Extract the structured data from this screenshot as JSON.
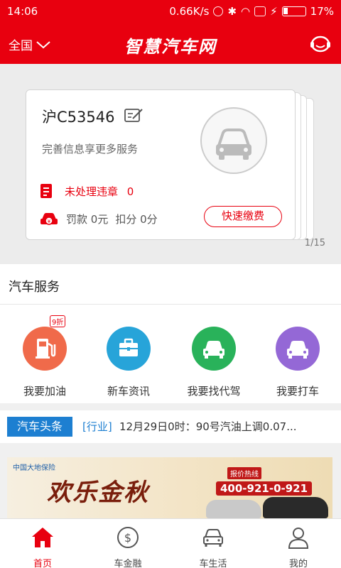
{
  "status_bar": {
    "time": "14:06",
    "net_speed": "0.66K/s",
    "battery_percent": "17%"
  },
  "header": {
    "region": "全国",
    "title": "智慧汽车网"
  },
  "car_card": {
    "plate": "沪C53546",
    "subtitle": "完善信息享更多服务",
    "violations_label": "未处理违章",
    "violations_count": "0",
    "fine_label": "罚款",
    "fine_value": "0元",
    "points_label": "扣分",
    "points_value": "0分",
    "quick_pay": "快速缴费",
    "pager": "1/15"
  },
  "services": {
    "title": "汽车服务",
    "discount_badge": "9折",
    "items": [
      {
        "label": "我要加油",
        "color": "#f06a4a",
        "icon": "fuel-pump-icon"
      },
      {
        "label": "新车资讯",
        "color": "#27a4d9",
        "icon": "briefcase-icon"
      },
      {
        "label": "我要找代驾",
        "color": "#29b25a",
        "icon": "car-icon"
      },
      {
        "label": "我要打车",
        "color": "#9468d6",
        "icon": "car-icon"
      }
    ]
  },
  "headline": {
    "tag": "汽车头条",
    "category": "[行业]",
    "text": "12月29日0时：90号汽油上调0.07..."
  },
  "banner": {
    "logo_text": "中国大地保险",
    "title": "欢乐金秋",
    "hotline_label": "报价热线",
    "hotline": "400-921-0-921"
  },
  "tabbar": {
    "items": [
      {
        "label": "首页",
        "icon": "home-icon",
        "active": true
      },
      {
        "label": "车金融",
        "icon": "dollar-coin-icon",
        "active": false
      },
      {
        "label": "车生活",
        "icon": "car-front-icon",
        "active": false
      },
      {
        "label": "我的",
        "icon": "user-icon",
        "active": false
      }
    ]
  },
  "colors": {
    "brand_red": "#e8000f",
    "headline_blue": "#1d7fd1"
  }
}
